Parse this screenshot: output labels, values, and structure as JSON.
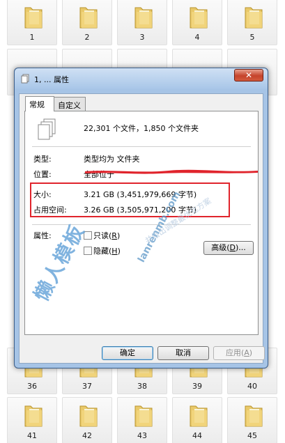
{
  "background_folders": {
    "top_row": [
      "1",
      "2",
      "3",
      "4",
      "5"
    ],
    "bottom_row_a": [
      "36",
      "37",
      "38",
      "39",
      "40"
    ],
    "bottom_row_b": [
      "41",
      "42",
      "43",
      "44",
      "45"
    ]
  },
  "window": {
    "title": "1, ... 属性",
    "close_label": "✕"
  },
  "tabs": [
    {
      "label": "常规",
      "active": true
    },
    {
      "label": "自定义",
      "active": false
    }
  ],
  "general": {
    "summary": "22,301 个文件，1,850 个文件夹",
    "type_label": "类型:",
    "type_value": "类型均为 文件夹",
    "location_label": "位置:",
    "location_value": "全部位于",
    "size_label": "大小:",
    "size_value": "3.21 GB (3,451,979,669 字节)",
    "disk_label": "占用空间:",
    "disk_value": "3.26 GB (3,505,971,200 字节)",
    "attributes_label": "属性:",
    "readonly_label": "只读",
    "readonly_key": "R",
    "hidden_label": "隐藏",
    "hidden_key": "H",
    "advanced_label": "高级",
    "advanced_key": "D"
  },
  "buttons": {
    "ok": "确定",
    "cancel": "取消",
    "apply": "应用",
    "apply_key": "A"
  },
  "watermark": {
    "main": "懒人模板",
    "domain": "lanrenmb.com",
    "slogan": "并给出调整最优化方案"
  },
  "colors": {
    "highlight": "#e0242c",
    "redaction": "#e0242c",
    "watermark": "#6aa6da"
  }
}
